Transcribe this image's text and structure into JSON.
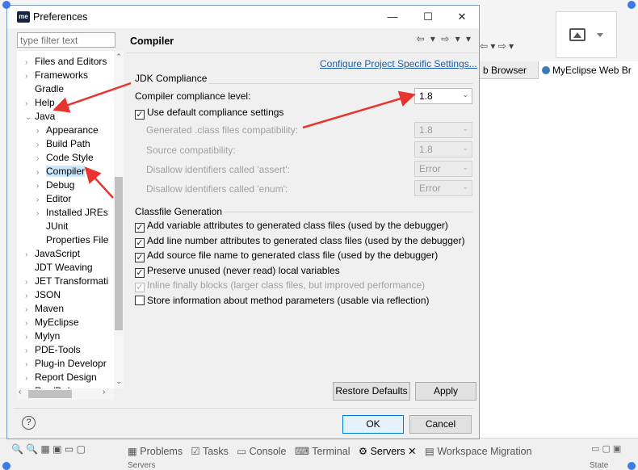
{
  "background": {
    "nav_icons": "⇦ ▾ ⇨ ▾",
    "editor_tabs": [
      "b Browser",
      "MyEclipse Web Br"
    ],
    "views": [
      "Problems",
      "Tasks",
      "Console",
      "Terminal",
      "Servers",
      "Workspace Migration"
    ],
    "servers_view_label": "Servers",
    "state_label": "State"
  },
  "window": {
    "title": "Preferences",
    "app_icon_text": "me",
    "minimize": "—",
    "maximize": "☐",
    "close": "✕"
  },
  "filter": {
    "placeholder": "type filter text"
  },
  "tree": {
    "items": [
      {
        "label": "Files and Editors",
        "chev": "›"
      },
      {
        "label": "Frameworks",
        "chev": "›"
      },
      {
        "label": "Gradle",
        "chev": ""
      },
      {
        "label": "Help",
        "chev": "›"
      },
      {
        "label": "Java",
        "chev": "⌄"
      },
      {
        "label": "Appearance",
        "chev": "›"
      },
      {
        "label": "Build Path",
        "chev": "›"
      },
      {
        "label": "Code Style",
        "chev": "›"
      },
      {
        "label": "Compiler",
        "chev": "›"
      },
      {
        "label": "Debug",
        "chev": "›"
      },
      {
        "label": "Editor",
        "chev": "›"
      },
      {
        "label": "Installed JREs",
        "chev": "›"
      },
      {
        "label": "JUnit",
        "chev": ""
      },
      {
        "label": "Properties File",
        "chev": ""
      },
      {
        "label": "JavaScript",
        "chev": "›"
      },
      {
        "label": "JDT Weaving",
        "chev": ""
      },
      {
        "label": "JET Transformati",
        "chev": "›"
      },
      {
        "label": "JSON",
        "chev": "›"
      },
      {
        "label": "Maven",
        "chev": "›"
      },
      {
        "label": "MyEclipse",
        "chev": "›"
      },
      {
        "label": "Mylyn",
        "chev": "›"
      },
      {
        "label": "PDE-Tools",
        "chev": "›"
      },
      {
        "label": "Plug-in Developr",
        "chev": "›"
      },
      {
        "label": "Report Design",
        "chev": "›"
      },
      {
        "label": "Run/Debug",
        "chev": "›"
      }
    ],
    "selected": "Compiler"
  },
  "page": {
    "title": "Compiler",
    "nav": "⇦ ▾ ⇨ ▾ ▾",
    "configure_link": "Configure Project Specific Settings...",
    "jdk_group_title": "JDK Compliance",
    "compliance_label": "Compiler compliance level:",
    "compliance_value": "1.8",
    "use_default_label": "Use default compliance settings",
    "use_default_checked": true,
    "generated_label": "Generated .class files compatibility:",
    "generated_value": "1.8",
    "source_label": "Source compatibility:",
    "source_value": "1.8",
    "assert_label": "Disallow identifiers called 'assert':",
    "assert_value": "Error",
    "enum_label": "Disallow identifiers called 'enum':",
    "enum_value": "Error",
    "classfile_group_title": "Classfile Generation",
    "classfile_options": [
      {
        "label": "Add variable attributes to generated class files (used by the debugger)",
        "checked": true,
        "enabled": true
      },
      {
        "label": "Add line number attributes to generated class files (used by the debugger)",
        "checked": true,
        "enabled": true
      },
      {
        "label": "Add source file name to generated class file (used by the debugger)",
        "checked": true,
        "enabled": true
      },
      {
        "label": "Preserve unused (never read) local variables",
        "checked": true,
        "enabled": true
      },
      {
        "label": "Inline finally blocks (larger class files, but improved performance)",
        "checked": true,
        "enabled": false
      },
      {
        "label": "Store information about method parameters (usable via reflection)",
        "checked": false,
        "enabled": true
      }
    ],
    "restore_defaults": "Restore Defaults",
    "apply": "Apply"
  },
  "footer": {
    "help": "?",
    "ok": "OK",
    "cancel": "Cancel"
  },
  "colors": {
    "annotation": "#e8342e",
    "link": "#1a5ea8",
    "selection": "#cce8ff"
  }
}
